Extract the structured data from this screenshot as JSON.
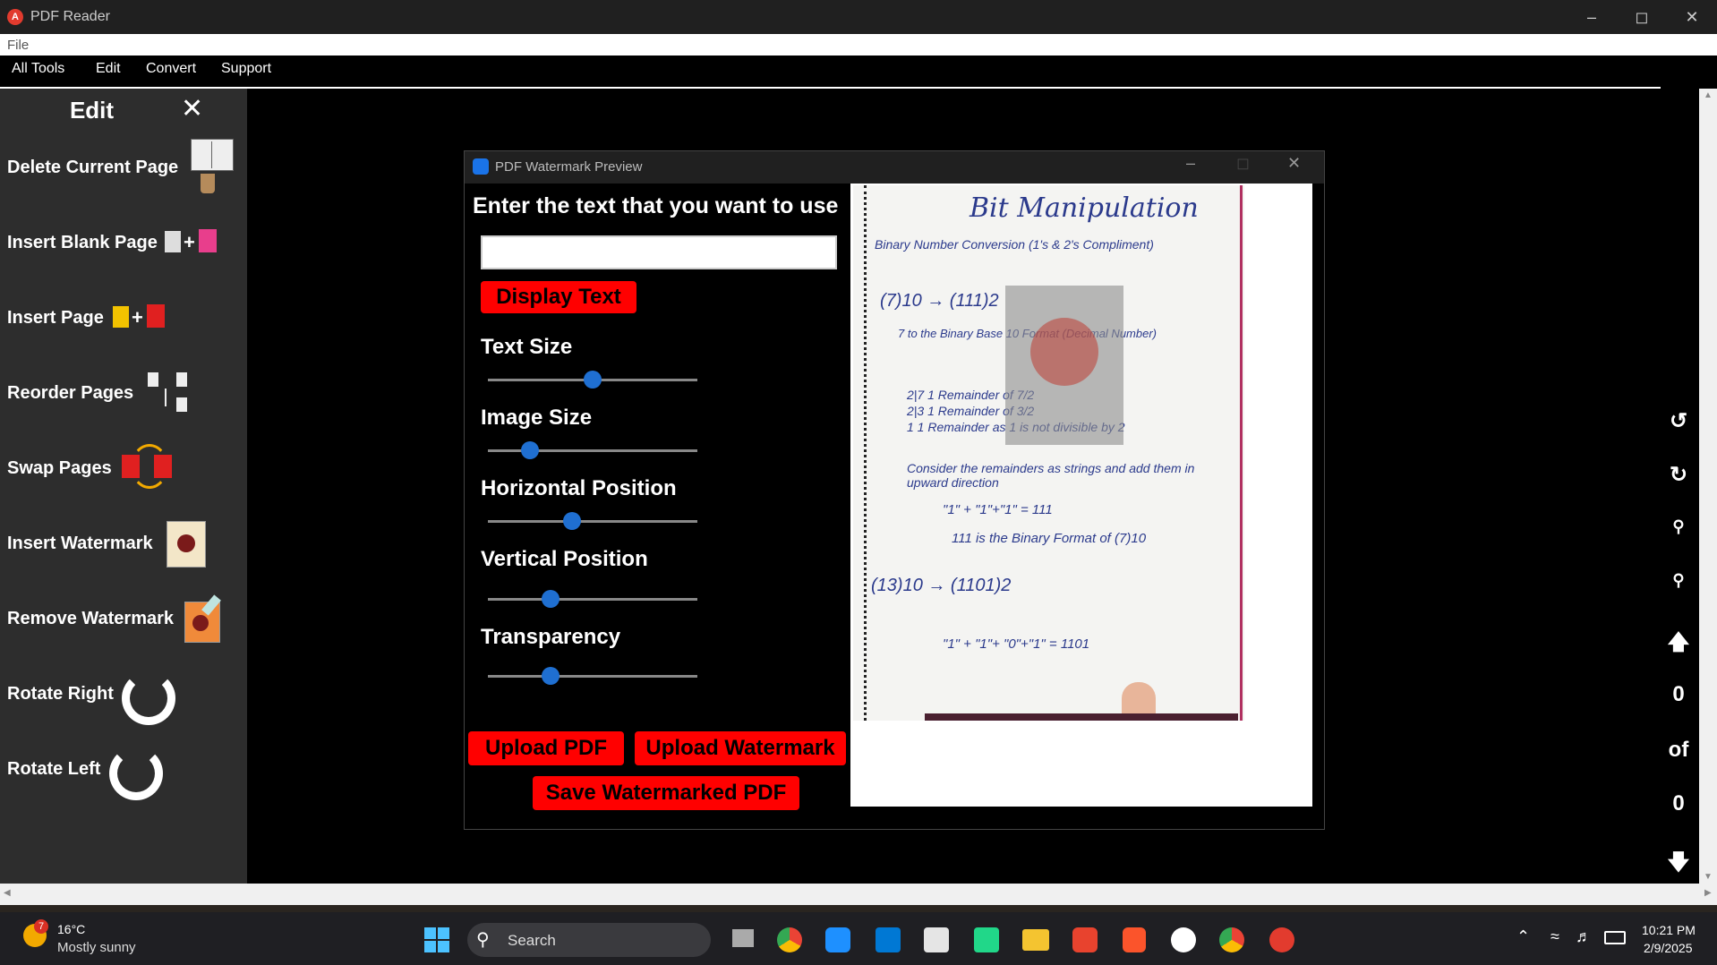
{
  "window": {
    "title": "PDF Reader",
    "icon_letter": "A"
  },
  "menu": {
    "file": "File"
  },
  "toolbar": {
    "items": [
      "All Tools",
      "Edit",
      "Convert",
      "Support"
    ]
  },
  "sidebar": {
    "title": "Edit",
    "close": "✕",
    "items": [
      {
        "label": "Delete Current Page",
        "icon": "delete-page-icon"
      },
      {
        "label": "Insert Blank Page",
        "icon": "insert-blank-page-icon"
      },
      {
        "label": "Insert Page",
        "icon": "insert-page-icon"
      },
      {
        "label": "Reorder Pages",
        "icon": "reorder-pages-icon"
      },
      {
        "label": "Swap Pages",
        "icon": "swap-pages-icon"
      },
      {
        "label": "Insert Watermark",
        "icon": "insert-watermark-icon"
      },
      {
        "label": "Remove Watermark",
        "icon": "remove-watermark-icon"
      },
      {
        "label": "Rotate Right",
        "icon": "rotate-right-icon"
      },
      {
        "label": "Rotate Left",
        "icon": "rotate-left-icon"
      }
    ]
  },
  "rightnav": {
    "page_current": "0",
    "of": "of",
    "page_total": "0"
  },
  "dialog": {
    "title": "PDF Watermark Preview",
    "prompt": "Enter the text that you want to use",
    "input_value": "",
    "display_text": "Display Text",
    "sliders": [
      {
        "label": "Text Size",
        "value": 0.5
      },
      {
        "label": "Image Size",
        "value": 0.2
      },
      {
        "label": "Horizontal Position",
        "value": 0.4
      },
      {
        "label": "Vertical Position",
        "value": 0.3
      },
      {
        "label": "Transparency",
        "value": 0.3
      }
    ],
    "upload_pdf": "Upload PDF",
    "upload_watermark": "Upload Watermark",
    "save": "Save Watermarked PDF"
  },
  "preview": {
    "heading": "Bit Manipulation",
    "lines": [
      "Binary Number Conversion (1's & 2's Compliment)",
      "(7)10 → (111)2",
      "7 to the Binary Base 10 Format (Decimal Number)",
      "2|7 1 Remainder of 7/2",
      "2|3 1 Remainder of 3/2",
      "1 1 Remainder as 1 is not divisible by 2",
      "Consider the remainders as strings and add them in upward direction",
      "\"1\" + \"1\"+\"1\" = 111",
      "111 is the Binary Format of (7)10",
      "(13)10 → (1101)2",
      "\"1\" + \"1\"+ \"0\"+\"1\" = 1101"
    ]
  },
  "taskbar": {
    "weather_temp": "16°C",
    "weather_desc": "Mostly sunny",
    "weather_badge": "7",
    "search": "Search",
    "time": "10:21 PM",
    "date": "2/9/2025"
  },
  "colors": {
    "accent_red": "#ff0000",
    "slider_blue": "#1f6fd1",
    "sidebar_bg": "#2d2d2d"
  }
}
